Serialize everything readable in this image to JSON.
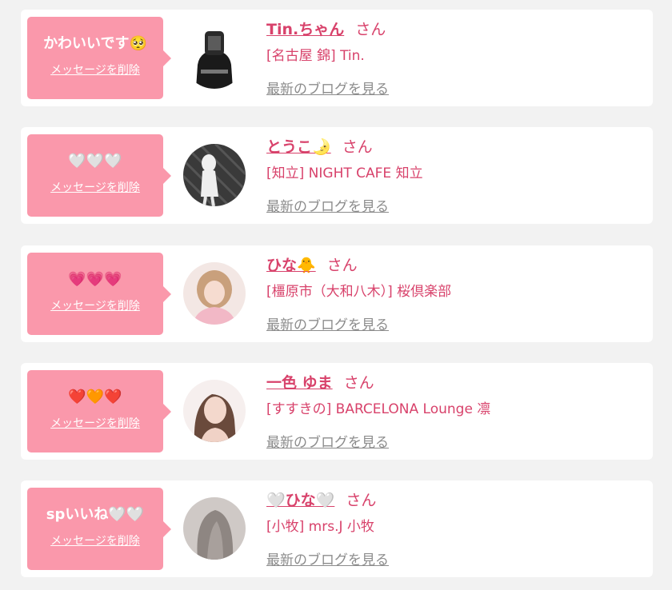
{
  "messages": [
    {
      "bubble_text": "かわいいです🥺",
      "delete_label": "メッセージを削除",
      "name": "Tin.ちゃん",
      "honorific": "さん",
      "shop": "[名古屋 錦] Tin.",
      "blog_label": "最新のブログを見る"
    },
    {
      "bubble_text": "🤍🤍🤍",
      "delete_label": "メッセージを削除",
      "name": "とうこ🌛",
      "honorific": "さん",
      "shop": "[知立] NIGHT CAFE 知立",
      "blog_label": "最新のブログを見る"
    },
    {
      "bubble_text": "💗💗💗",
      "delete_label": "メッセージを削除",
      "name": "ひな🐥",
      "honorific": "さん",
      "shop": "[橿原市（大和八木）] 桜倶楽部",
      "blog_label": "最新のブログを見る"
    },
    {
      "bubble_text": "❤️🧡❤️",
      "delete_label": "メッセージを削除",
      "name": "一色 ゆま",
      "honorific": "さん",
      "shop": "[すすきの] BARCELONA Lounge 凛",
      "blog_label": "最新のブログを見る"
    },
    {
      "bubble_text": "spいいね🤍🤍",
      "delete_label": "メッセージを削除",
      "name": "🤍ひな🤍",
      "honorific": "さん",
      "shop": "[小牧] mrs.J 小牧",
      "blog_label": "最新のブログを見る"
    }
  ],
  "colors": {
    "page_bg": "#f2f2f2",
    "card_bg": "#ffffff",
    "bubble_bg": "#fa98ab",
    "accent_pink": "#d8426b",
    "blog_link_gray": "#8c8c8c"
  }
}
